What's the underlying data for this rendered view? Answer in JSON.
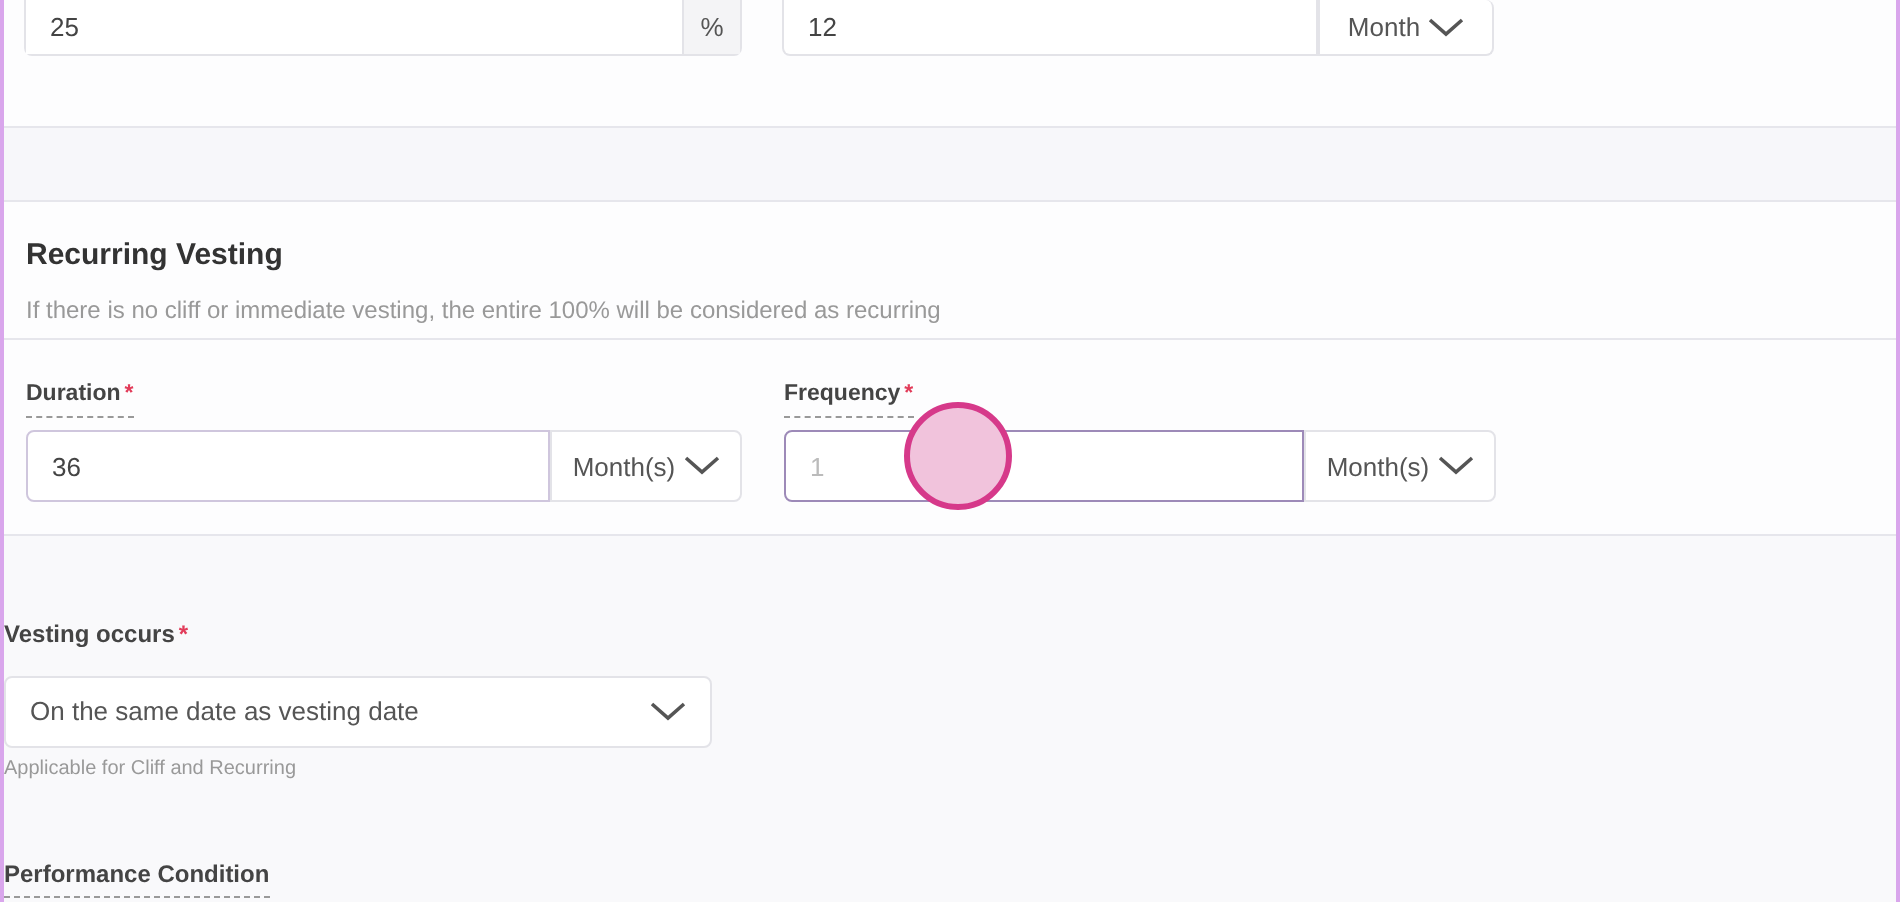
{
  "top_row": [
    {
      "value": "25",
      "unit": "%",
      "kind": "addon"
    },
    {
      "value": "12",
      "unit": "Month",
      "kind": "dropdown"
    }
  ],
  "recurring_vesting": {
    "title": "Recurring Vesting",
    "description": "If there is no cliff or immediate vesting, the entire 100% will be considered as recurring",
    "fields": [
      {
        "label": "Duration",
        "required_mark": "*",
        "value": "36",
        "unit": "Month(s)",
        "focused": false
      },
      {
        "label": "Frequency",
        "required_mark": "*",
        "placeholder": "1",
        "unit": "Month(s)",
        "focused": true
      }
    ]
  },
  "vesting_occurs": {
    "label": "Vesting occurs",
    "required_mark": "*",
    "value": "On the same date as vesting date",
    "hint": "Applicable for Cliff and Recurring"
  },
  "performance_condition": {
    "label": "Performance Condition"
  }
}
